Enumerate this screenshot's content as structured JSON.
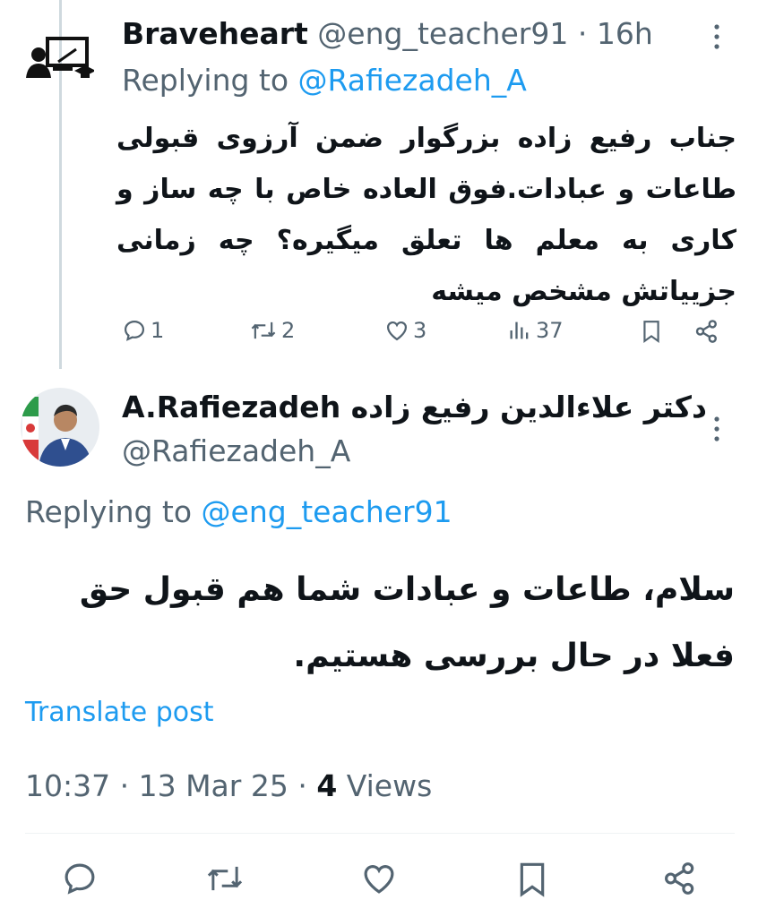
{
  "parent": {
    "display_name": "Braveheart",
    "handle": "@eng_teacher91",
    "separator": " · ",
    "time": "16h",
    "replying_label": "Replying to ",
    "replying_handle": "@Rafiezadeh_A",
    "text": "جناب رفیع زاده بزرگوار ضمن آرزوی قبولی طاعات و عبادات.فوق العاده خاص با چه ساز و کاری به معلم ها تعلق میگیره؟ چه زمانی جزییاتش مشخص میشه",
    "stats": {
      "replies": "1",
      "reposts": "2",
      "likes": "3",
      "views": "37"
    }
  },
  "main": {
    "display_name": "A.Rafiezadeh دکتر علاءالدین رفیع زاده",
    "handle": "@Rafiezadeh_A",
    "replying_label": "Replying to ",
    "replying_handle": "@eng_teacher91",
    "text": "سلام، طاعات و عبادات شما هم قبول حق فعلا در حال بررسی هستیم.",
    "translate_label": "Translate post",
    "time": "10:37",
    "date": "13 Mar 25",
    "views_count": "4",
    "views_label": " Views",
    "separator": " · "
  },
  "icons": [
    "more-icon",
    "reply-icon",
    "repost-icon",
    "like-icon",
    "views-icon",
    "bookmark-icon",
    "share-icon"
  ],
  "colors": {
    "link": "#1d9bf0",
    "muted": "#536471",
    "text": "#0f1419",
    "thread_line": "#cfd9de"
  }
}
